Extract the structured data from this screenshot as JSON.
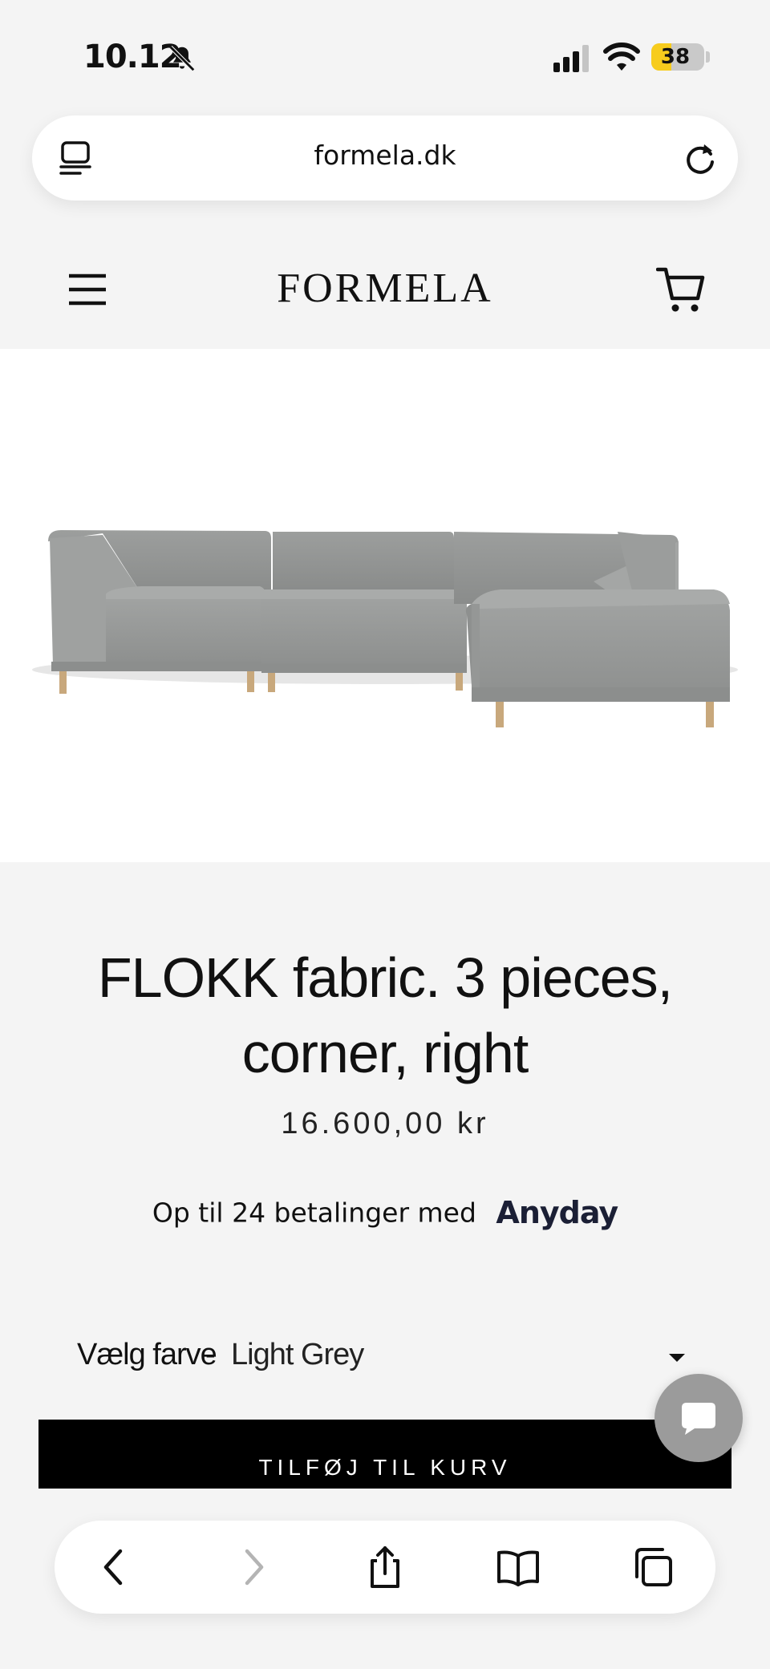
{
  "status_bar": {
    "time": "10.12",
    "battery": "38",
    "battery_level": 0.38,
    "icons": [
      "bell-off-icon",
      "signal-icon",
      "wifi-icon",
      "battery-icon"
    ]
  },
  "browser": {
    "url": "formela.dk",
    "toolbar_icons": [
      "back-icon",
      "forward-icon",
      "share-icon",
      "bookmarks-icon",
      "tabs-icon"
    ]
  },
  "site": {
    "logo": "FORMELA",
    "icons": [
      "hamburger-icon",
      "cart-icon"
    ]
  },
  "product": {
    "title": "FLOKK fabric. 3 pieces, corner, right",
    "price": "16.600,00 kr",
    "installments_text": "Op til 24 betalinger med",
    "installments_provider": "Anyday",
    "color_label": "Vælg farve",
    "color_separator": "-",
    "color_value": "Light Grey",
    "add_to_cart": "TILFØJ TIL KURV"
  },
  "colors": {
    "background": "#f4f4f4",
    "button": "#000000",
    "sofa": "#9a9c9b",
    "battery": "#f7cc1d",
    "chat": "#9b9b9b",
    "anyday": "#1b1f35"
  }
}
